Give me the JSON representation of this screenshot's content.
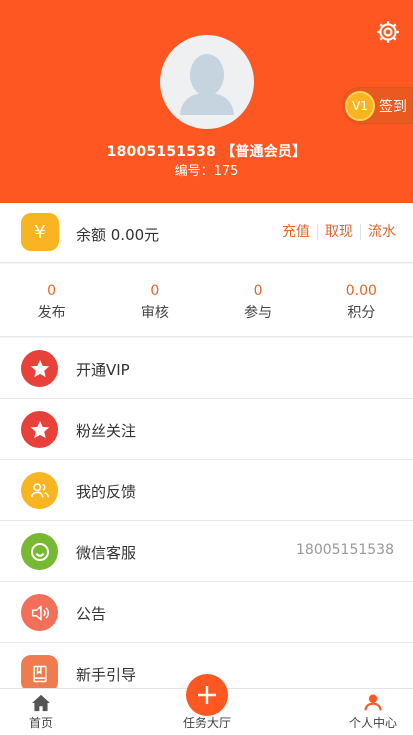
{
  "header": {
    "phone_line": "18005151538 【普通会员】",
    "id_line": "编号：175",
    "signin": {
      "badge": "V1",
      "label": "签到"
    },
    "icons": {
      "settings": "gear-icon",
      "avatar": "default-avatar-icon"
    }
  },
  "balance": {
    "text": "余额 0.00元",
    "icon": "¥",
    "links": [
      "充值",
      "取现",
      "流水"
    ]
  },
  "stats": [
    {
      "value": "0",
      "label": "发布"
    },
    {
      "value": "0",
      "label": "审核"
    },
    {
      "value": "0",
      "label": "参与"
    },
    {
      "value": "0.00",
      "label": "积分"
    }
  ],
  "menu": [
    {
      "label": "开通VIP",
      "icon": "star-icon",
      "color": "#e8413a",
      "value": ""
    },
    {
      "label": "粉丝关注",
      "icon": "star-icon",
      "color": "#e8413a",
      "value": ""
    },
    {
      "label": "我的反馈",
      "icon": "users-icon",
      "color": "#f9b521",
      "value": ""
    },
    {
      "label": "微信客服",
      "icon": "chat-icon",
      "color": "#78b832",
      "value": "18005151538"
    },
    {
      "label": "公告",
      "icon": "speaker-icon",
      "color": "#f2705a",
      "value": ""
    },
    {
      "label": "新手引导",
      "icon": "book-icon",
      "color": "#ef7b4f",
      "value": ""
    }
  ],
  "tabbar": {
    "home": "首页",
    "task": "任务大厅",
    "me": "个人中心"
  },
  "colors": {
    "primary": "#ff5722",
    "accent_text": "#e0672e",
    "gold": "#f9b521"
  }
}
